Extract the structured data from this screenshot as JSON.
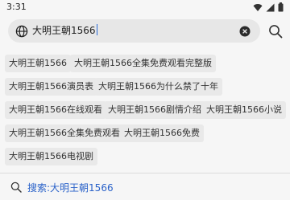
{
  "status_bar": {
    "time": "3:31"
  },
  "search": {
    "query": "大明王朝1566"
  },
  "suggestions": [
    "大明王朝1566",
    "大明王朝1566全集免费观看完整版",
    "大明王朝1566演员表",
    "大明王朝1566为什么禁了十年",
    "大明王朝1566在线观看",
    "大明王朝1566剧情介绍",
    "大明王朝1566小说",
    "大明王朝1566全集免费观看",
    "大明王朝1566免费",
    "大明王朝1566电视剧"
  ],
  "search_suggestion": {
    "label": "搜索:大明王朝1566"
  },
  "colors": {
    "accent": "#2a62c9",
    "chip": "#e9e9e9",
    "background": "#f6f6f6"
  }
}
